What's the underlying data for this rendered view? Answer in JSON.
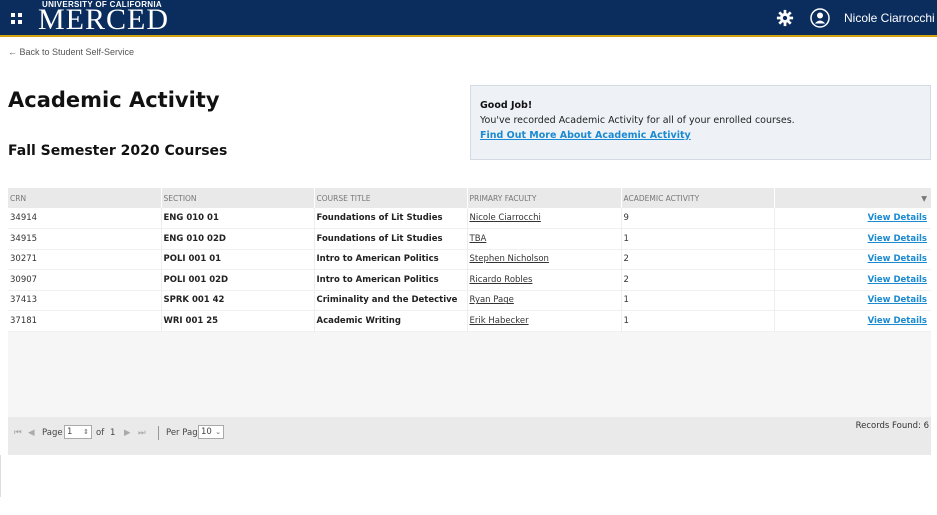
{
  "header": {
    "logo_top": "UNIVERSITY OF CALIFORNIA",
    "logo_main": "MERCED",
    "user_name": "Nicole Ciarrocchi",
    "icons": [
      "menu-grid-icon",
      "gear-icon",
      "user-icon"
    ],
    "colors": {
      "bar": "#0a2d5e",
      "accent": "#d3a30f"
    }
  },
  "nav": {
    "back_label": "← Back to Student Self-Service"
  },
  "page": {
    "title": "Academic Activity",
    "term_title": "Fall Semester 2020 Courses"
  },
  "notice": {
    "title": "Good Job!",
    "message": "You've recorded Academic Activity for all of your enrolled courses.",
    "link": "Find Out More About Academic Activity"
  },
  "table": {
    "columns": [
      "CRN",
      "SECTION",
      "COURSE TITLE",
      "PRIMARY FACULTY",
      "ACADEMIC ACTIVITY"
    ],
    "menu_icon": "▼",
    "action_label": "View Details",
    "rows": [
      {
        "crn": "34914",
        "section": "ENG 010 01",
        "title": "Foundations of Lit Studies",
        "faculty": "Nicole Ciarrocchi",
        "activity": "9"
      },
      {
        "crn": "34915",
        "section": "ENG 010 02D",
        "title": "Foundations of Lit Studies",
        "faculty": "TBA",
        "activity": "1"
      },
      {
        "crn": "30271",
        "section": "POLI 001 01",
        "title": "Intro to American Politics",
        "faculty": "Stephen Nicholson",
        "activity": "2"
      },
      {
        "crn": "30907",
        "section": "POLI 001 02D",
        "title": "Intro to American Politics",
        "faculty": "Ricardo Robles",
        "activity": "2"
      },
      {
        "crn": "37413",
        "section": "SPRK 001 42",
        "title": "Criminality and the Detective",
        "faculty": "Ryan Page",
        "activity": "1"
      },
      {
        "crn": "37181",
        "section": "WRI 001 25",
        "title": "Academic Writing",
        "faculty": "Erik Habecker",
        "activity": "1"
      }
    ]
  },
  "pager": {
    "page_label": "Page",
    "page_value": "1",
    "of_label": "of",
    "total_pages": "1",
    "per_page_label": "Per Page",
    "per_page_value": "10",
    "records_label": "Records Found: 6"
  }
}
